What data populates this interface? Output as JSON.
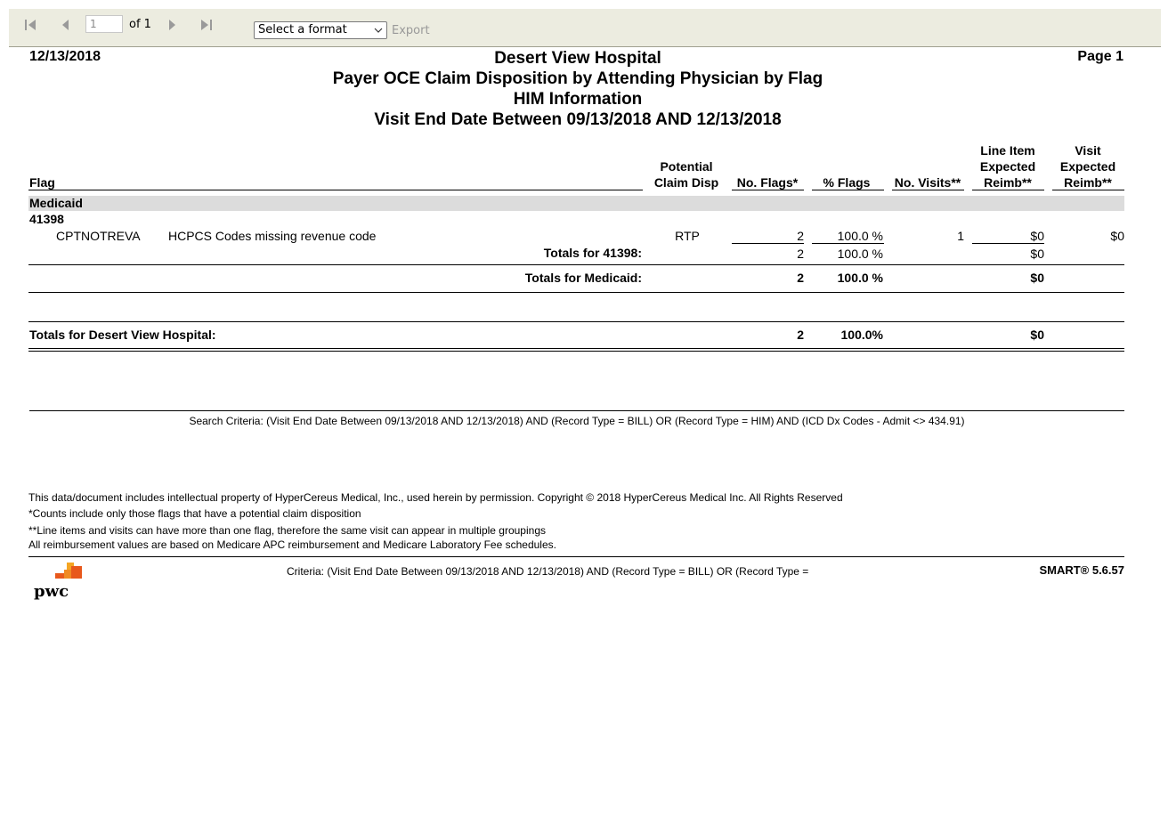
{
  "toolbar": {
    "page_value": "1",
    "of_label": "of 1",
    "format_placeholder": "Select a format",
    "export_label": "Export",
    "icons": [
      "first-page-icon",
      "prev-page-icon",
      "next-page-icon",
      "last-page-icon"
    ]
  },
  "report": {
    "date": "12/13/2018",
    "page": "Page 1",
    "titles": [
      "Desert View Hospital",
      "Payer OCE Claim Disposition by Attending Physician by Flag",
      "HIM Information",
      "Visit End Date Between 09/13/2018 AND 12/13/2018"
    ]
  },
  "columns": {
    "flag": "Flag",
    "potential_1": "Potential",
    "potential_2": "Claim Disp",
    "no_flags": "No. Flags*",
    "pct_flags": "% Flags",
    "no_visits": "No. Visits**",
    "line_item_1": "Line Item",
    "line_item_2": "Expected",
    "line_item_3": "Reimb**",
    "visit_1": "Visit",
    "visit_2": "Expected",
    "visit_3": "Reimb**"
  },
  "group": {
    "payer": "Medicaid",
    "physician": "41398",
    "row": {
      "code": "CPTNOTREVA",
      "description": "HCPCS Codes missing revenue code",
      "disp": "RTP",
      "no_flags": "2",
      "pct_flags": "100.0 %",
      "no_visits": "1",
      "line_reimb": "$0",
      "visit_reimb": "$0"
    },
    "physician_totals": {
      "label": "Totals for 41398:",
      "no_flags": "2",
      "pct_flags": "100.0 %",
      "line_reimb": "$0"
    },
    "payer_totals": {
      "label": "Totals for Medicaid:",
      "no_flags": "2",
      "pct_flags": "100.0 %",
      "line_reimb": "$0"
    }
  },
  "grand_totals": {
    "label": "Totals for Desert View Hospital:",
    "no_flags": "2",
    "pct_flags": "100.0%",
    "line_reimb": "$0"
  },
  "search_criteria": "Search Criteria: (Visit End Date Between 09/13/2018 AND 12/13/2018) AND (Record Type = BILL) OR (Record Type = HIM) AND (ICD Dx Codes - Admit <> 434.91)",
  "notes": [
    "This data/document includes intellectual property of HyperCereus Medical, Inc., used herein by permission. Copyright © 2018 HyperCereus Medical Inc. All Rights Reserved",
    "*Counts include only those flags that have a potential claim disposition",
    "**Line items and visits can have more than one flag, therefore the same visit can appear in multiple groupings",
    "All reimbursement values are based on Medicare APC reimbursement and Medicare Laboratory Fee schedules."
  ],
  "footer": {
    "logo_text": "pwc",
    "criteria": "Criteria: (Visit End Date Between 09/13/2018 AND 12/13/2018) AND (Record Type = BILL) OR (Record Type =",
    "version": "SMART® 5.6.57",
    "colors": {
      "logo_orange": "#e8581c",
      "logo_light": "#f5a623",
      "toolbar_bg": "#ecece0",
      "group_band": "#dcdcdc"
    }
  }
}
